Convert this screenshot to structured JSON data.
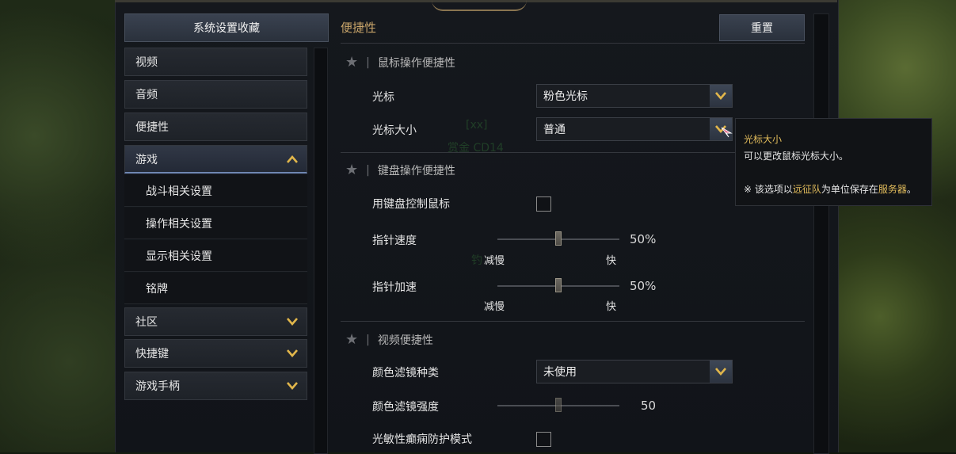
{
  "left_panel": {
    "title": "系统设置收藏",
    "nav_items": [
      {
        "label": "视频"
      },
      {
        "label": "音频"
      },
      {
        "label": "便捷性"
      },
      {
        "label": "游戏",
        "expanded": true
      },
      {
        "label": "社区"
      },
      {
        "label": "快捷键"
      },
      {
        "label": "游戏手柄"
      }
    ],
    "sub_items": [
      {
        "label": "战斗相关设置"
      },
      {
        "label": "操作相关设置"
      },
      {
        "label": "显示相关设置"
      },
      {
        "label": "铭牌"
      }
    ]
  },
  "main": {
    "section_title": "便捷性",
    "reset_label": "重置",
    "groups": {
      "mouse": {
        "title": "鼠标操作便捷性",
        "cursor_label": "光标",
        "cursor_value": "粉色光标",
        "cursor_size_label": "光标大小",
        "cursor_size_value": "普通"
      },
      "keyboard": {
        "title": "键盘操作便捷性",
        "keyboard_mouse_label": "用键盘控制鼠标",
        "keyboard_mouse_checked": false,
        "pointer_speed_label": "指针速度",
        "pointer_speed_value": "50%",
        "pointer_speed_fraction": 0.5,
        "pointer_speed_min": "减慢",
        "pointer_speed_max": "快",
        "pointer_accel_label": "指针加速",
        "pointer_accel_value": "50%",
        "pointer_accel_fraction": 0.5,
        "pointer_accel_min": "减慢",
        "pointer_accel_max": "快"
      },
      "video": {
        "title": "视频便捷性",
        "filter_type_label": "颜色滤镜种类",
        "filter_type_value": "未使用",
        "filter_strength_label": "颜色滤镜强度",
        "filter_strength_value": "50",
        "filter_strength_fraction": 0.5,
        "photosensitive_label": "光敏性癫痫防护模式",
        "photosensitive_checked": false
      }
    }
  },
  "tooltip": {
    "title": "光标大小",
    "line1": "可以更改鼠标光标大小。",
    "note_prefix": "※ 该选项以",
    "note_hl1": "远征队",
    "note_mid": "为单位保存在",
    "note_hl2": "服务器",
    "note_suffix": "。"
  },
  "background_text": {
    "ghost1": "[xx]",
    "ghost2": "赏金 CD14",
    "ghost3": "钓"
  },
  "colors": {
    "accent_gold": "#c9a56a",
    "highlight_yellow": "#e3bd5c",
    "active_underline": "#6f87b3"
  }
}
